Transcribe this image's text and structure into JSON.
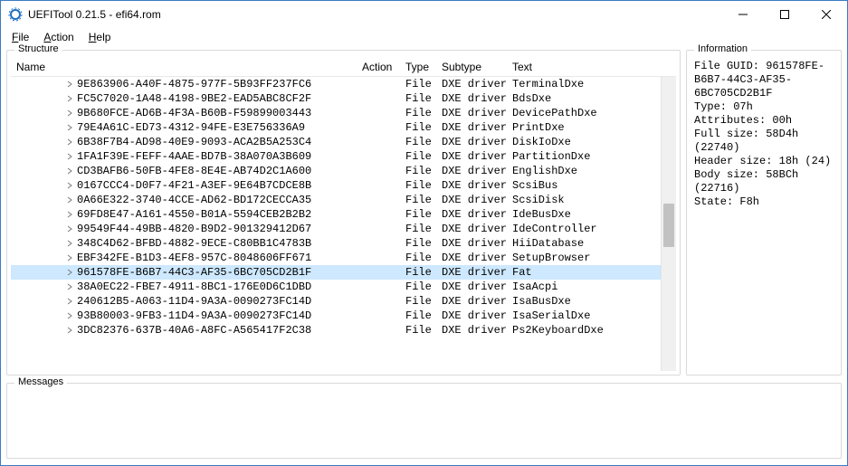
{
  "window": {
    "title": "UEFITool 0.21.5 - efi64.rom"
  },
  "menu": {
    "file": "File",
    "action": "Action",
    "help": "Help"
  },
  "panels": {
    "structure": "Structure",
    "information": "Information",
    "messages": "Messages"
  },
  "headers": {
    "name": "Name",
    "action": "Action",
    "type": "Type",
    "subtype": "Subtype",
    "text": "Text"
  },
  "rows": [
    {
      "name": "9E863906-A40F-4875-977F-5B93FF237FC6",
      "action": "",
      "type": "File",
      "subtype": "DXE driver",
      "text": "TerminalDxe",
      "sel": false
    },
    {
      "name": "FC5C7020-1A48-4198-9BE2-EAD5ABC8CF2F",
      "action": "",
      "type": "File",
      "subtype": "DXE driver",
      "text": "BdsDxe",
      "sel": false
    },
    {
      "name": "9B680FCE-AD6B-4F3A-B60B-F59899003443",
      "action": "",
      "type": "File",
      "subtype": "DXE driver",
      "text": "DevicePathDxe",
      "sel": false
    },
    {
      "name": "79E4A61C-ED73-4312-94FE-E3E756336A9",
      "action": "",
      "type": "File",
      "subtype": "DXE driver",
      "text": "PrintDxe",
      "sel": false
    },
    {
      "name": "6B38F7B4-AD98-40E9-9093-ACA2B5A253C4",
      "action": "",
      "type": "File",
      "subtype": "DXE driver",
      "text": "DiskIoDxe",
      "sel": false
    },
    {
      "name": "1FA1F39E-FEFF-4AAE-BD7B-38A070A3B609",
      "action": "",
      "type": "File",
      "subtype": "DXE driver",
      "text": "PartitionDxe",
      "sel": false
    },
    {
      "name": "CD3BAFB6-50FB-4FE8-8E4E-AB74D2C1A600",
      "action": "",
      "type": "File",
      "subtype": "DXE driver",
      "text": "EnglishDxe",
      "sel": false
    },
    {
      "name": "0167CCC4-D0F7-4F21-A3EF-9E64B7CDCE8B",
      "action": "",
      "type": "File",
      "subtype": "DXE driver",
      "text": "ScsiBus",
      "sel": false
    },
    {
      "name": "0A66E322-3740-4CCE-AD62-BD172CECCA35",
      "action": "",
      "type": "File",
      "subtype": "DXE driver",
      "text": "ScsiDisk",
      "sel": false
    },
    {
      "name": "69FD8E47-A161-4550-B01A-5594CEB2B2B2",
      "action": "",
      "type": "File",
      "subtype": "DXE driver",
      "text": "IdeBusDxe",
      "sel": false
    },
    {
      "name": "99549F44-49BB-4820-B9D2-901329412D67",
      "action": "",
      "type": "File",
      "subtype": "DXE driver",
      "text": "IdeController",
      "sel": false
    },
    {
      "name": "348C4D62-BFBD-4882-9ECE-C80BB1C4783B",
      "action": "",
      "type": "File",
      "subtype": "DXE driver",
      "text": "HiiDatabase",
      "sel": false
    },
    {
      "name": "EBF342FE-B1D3-4EF8-957C-8048606FF671",
      "action": "",
      "type": "File",
      "subtype": "DXE driver",
      "text": "SetupBrowser",
      "sel": false
    },
    {
      "name": "961578FE-B6B7-44C3-AF35-6BC705CD2B1F",
      "action": "",
      "type": "File",
      "subtype": "DXE driver",
      "text": "Fat",
      "sel": true
    },
    {
      "name": "38A0EC22-FBE7-4911-8BC1-176E0D6C1DBD",
      "action": "",
      "type": "File",
      "subtype": "DXE driver",
      "text": "IsaAcpi",
      "sel": false
    },
    {
      "name": "240612B5-A063-11D4-9A3A-0090273FC14D",
      "action": "",
      "type": "File",
      "subtype": "DXE driver",
      "text": "IsaBusDxe",
      "sel": false
    },
    {
      "name": "93B80003-9FB3-11D4-9A3A-0090273FC14D",
      "action": "",
      "type": "File",
      "subtype": "DXE driver",
      "text": "IsaSerialDxe",
      "sel": false
    },
    {
      "name": "3DC82376-637B-40A6-A8FC-A565417F2C38",
      "action": "",
      "type": "File",
      "subtype": "DXE driver",
      "text": "Ps2KeyboardDxe",
      "sel": false
    }
  ],
  "info": {
    "lines": [
      "File GUID: 961578FE-B6B7-44C3-AF35-6BC705CD2B1F",
      "Type: 07h",
      "Attributes: 00h",
      "Full size: 58D4h (22740)",
      "Header size: 18h (24)",
      "Body size: 58BCh (22716)",
      "State: F8h"
    ]
  }
}
